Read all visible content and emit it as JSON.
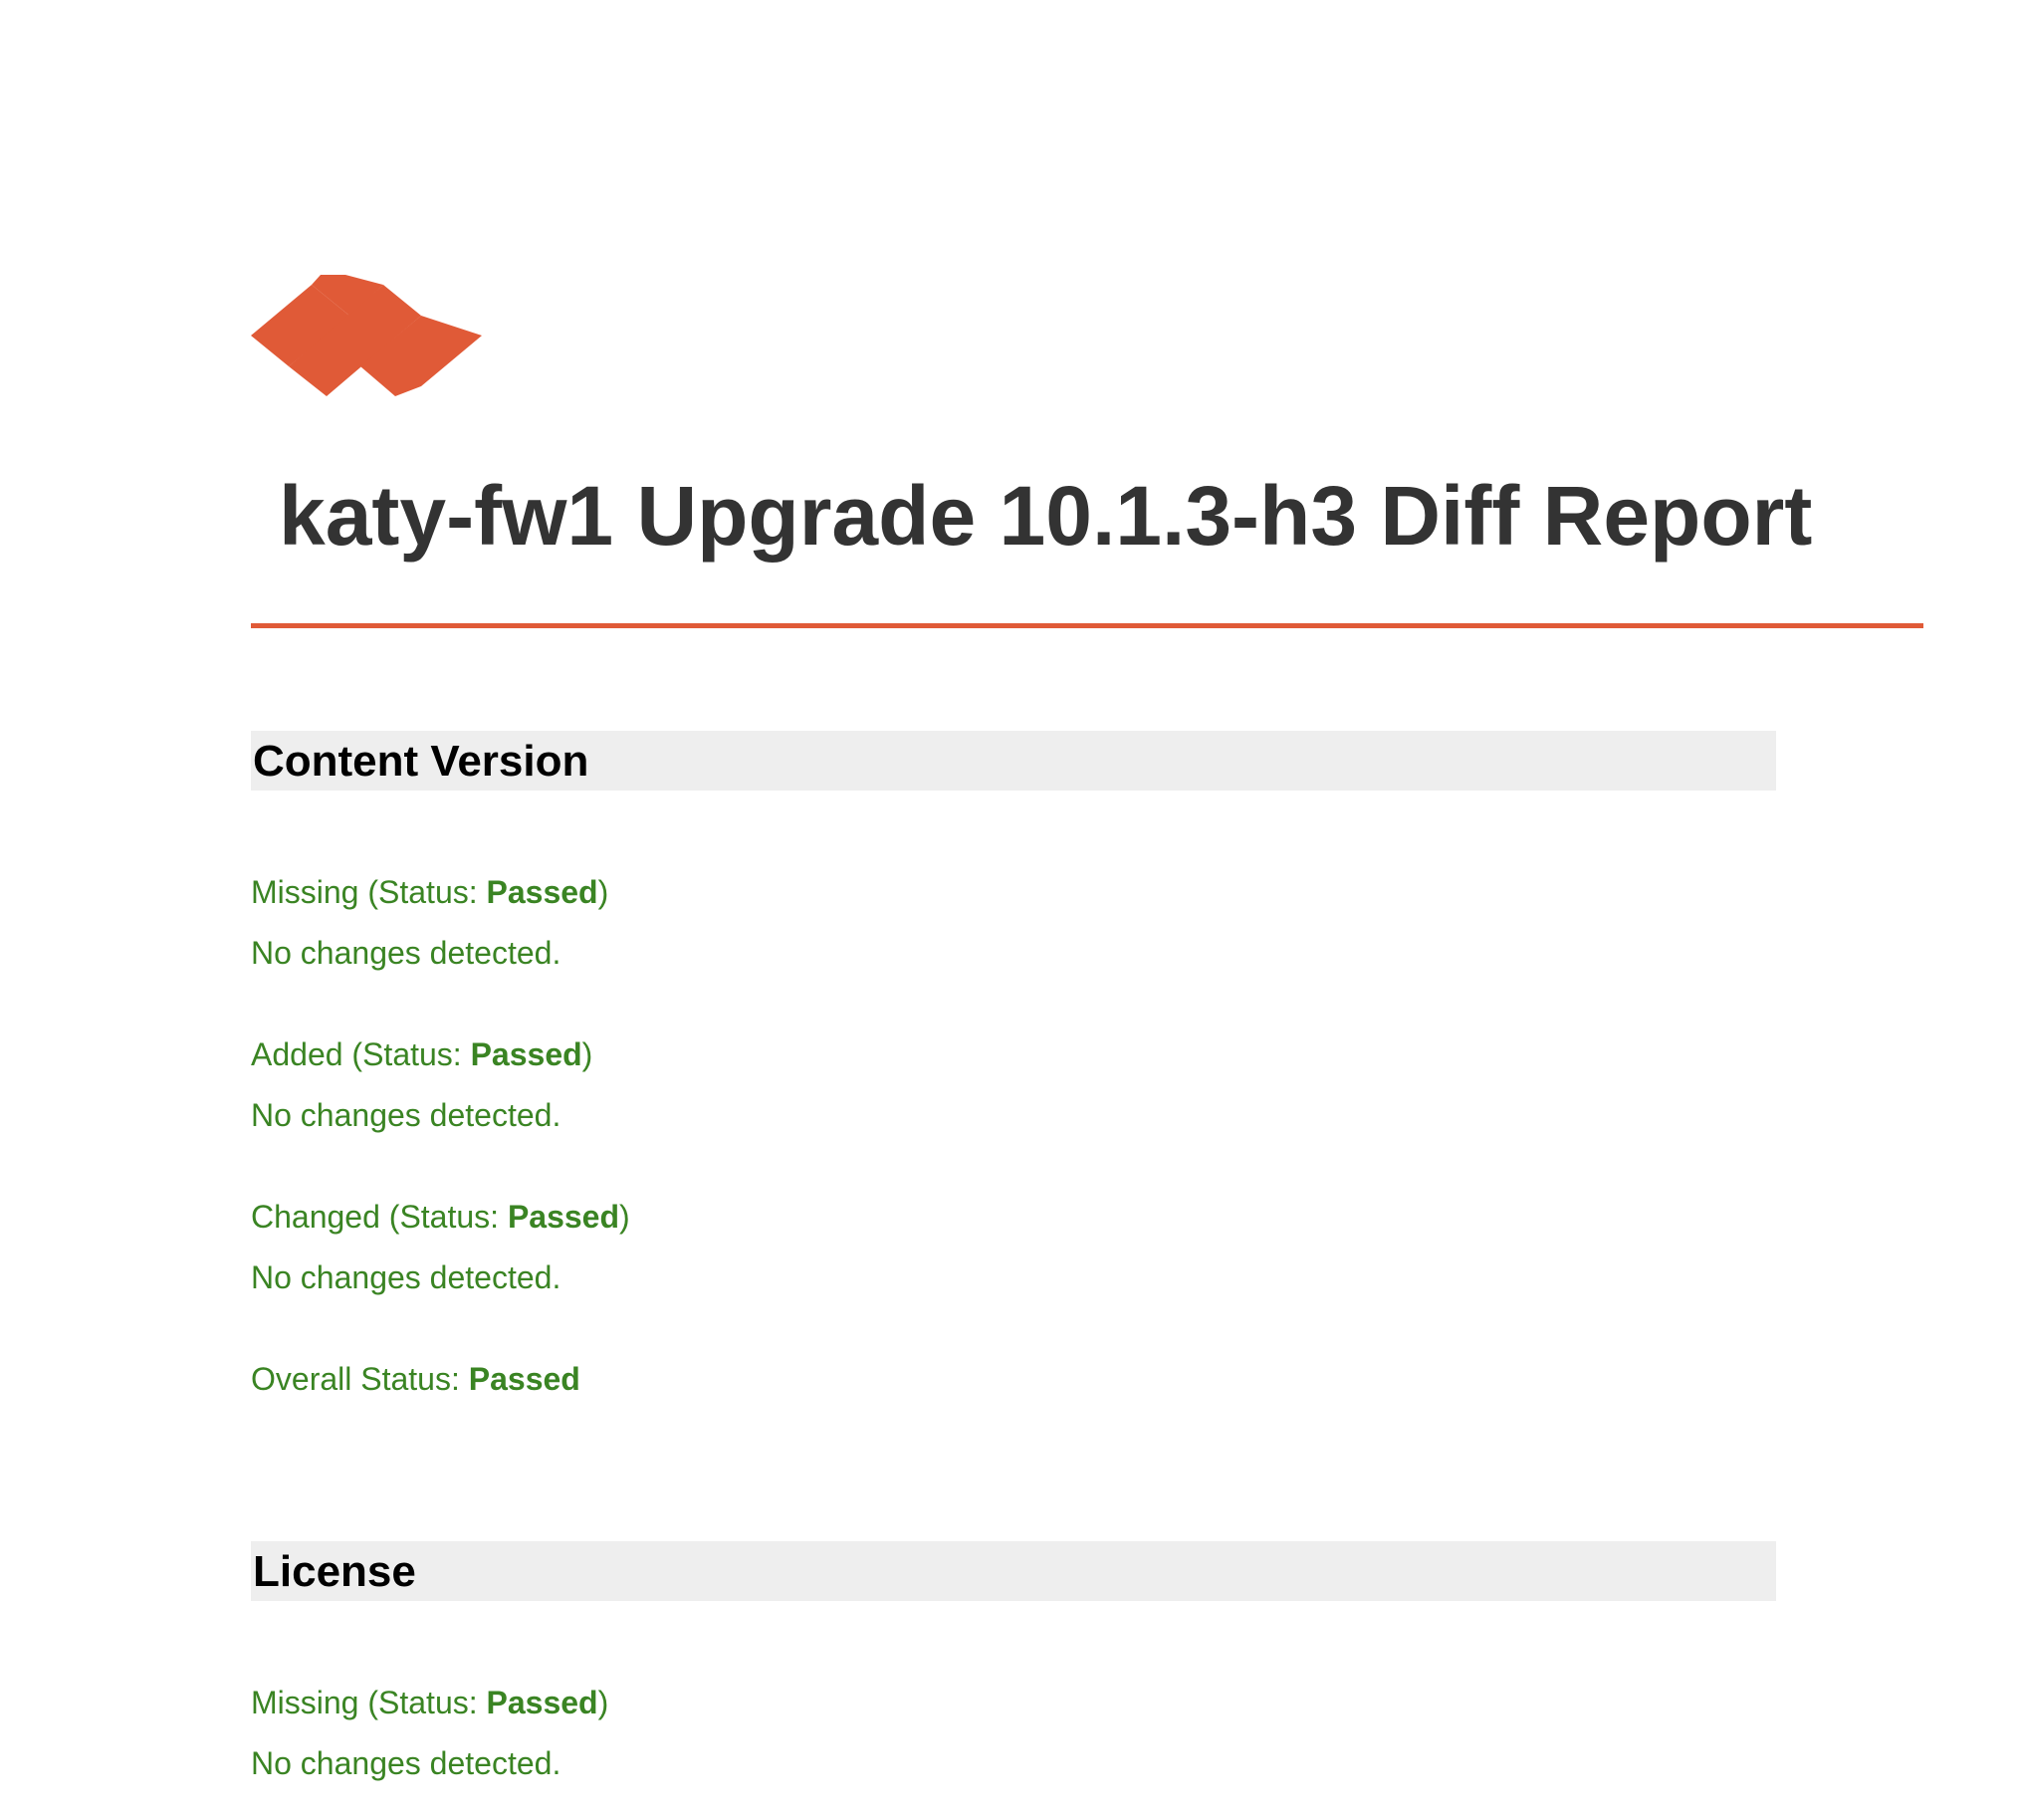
{
  "colors": {
    "brand": "#e05a37",
    "title_text": "#333333",
    "status_passed": "#3a8423",
    "heading_bg": "#eeeeee"
  },
  "logo": {
    "icon": "brand-logo-icon"
  },
  "report": {
    "title": "katy-fw1 Upgrade 10.1.3-h3 Diff Report"
  },
  "sections": [
    {
      "heading": "Content Version",
      "checks": [
        {
          "label": "Missing",
          "status_prefix": " (Status: ",
          "status": "Passed",
          "status_suffix": ")",
          "detail": "No changes detected."
        },
        {
          "label": "Added",
          "status_prefix": " (Status: ",
          "status": "Passed",
          "status_suffix": ")",
          "detail": "No changes detected."
        },
        {
          "label": "Changed",
          "status_prefix": " (Status: ",
          "status": "Passed",
          "status_suffix": ")",
          "detail": "No changes detected."
        }
      ],
      "overall": {
        "label": "Overall Status: ",
        "status": "Passed"
      }
    },
    {
      "heading": "License",
      "checks": [
        {
          "label": "Missing",
          "status_prefix": " (Status: ",
          "status": "Passed",
          "status_suffix": ")",
          "detail": "No changes detected."
        }
      ]
    }
  ]
}
